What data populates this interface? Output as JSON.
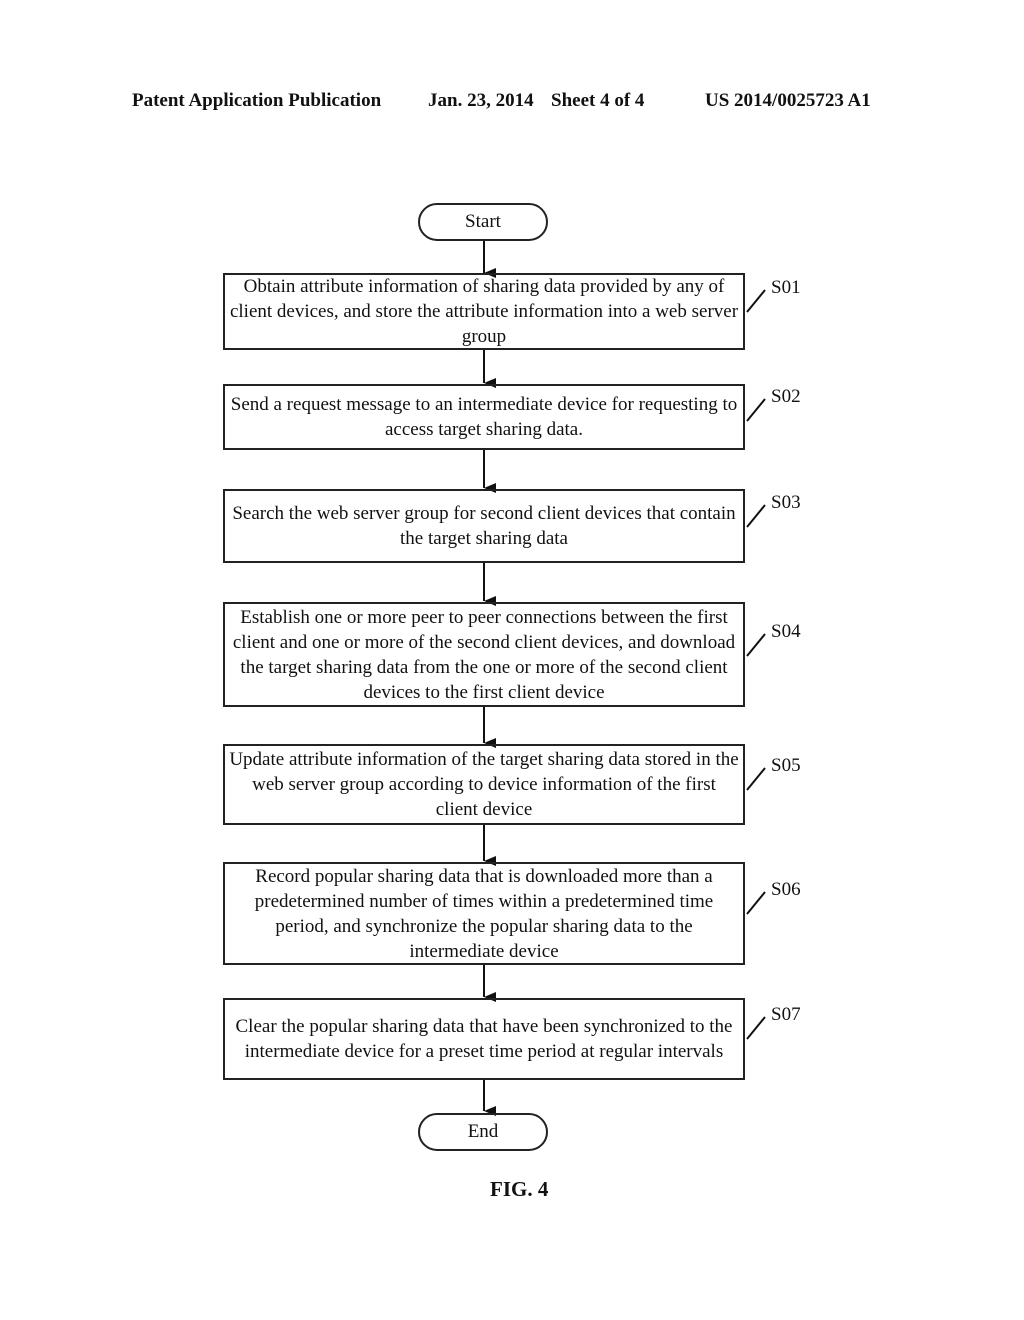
{
  "header": {
    "publication": "Patent Application Publication",
    "date": "Jan. 23, 2014",
    "sheet": "Sheet 4 of 4",
    "number": "US 2014/0025723 A1"
  },
  "flowchart": {
    "start": "Start",
    "end": "End",
    "steps": [
      {
        "id": "S01",
        "text": "Obtain attribute information of sharing data provided by any of client devices, and store the attribute information into a web server group"
      },
      {
        "id": "S02",
        "text": "Send a request message to an intermediate device for requesting to access target sharing data."
      },
      {
        "id": "S03",
        "text": "Search the web server group for second client devices that contain the target sharing data"
      },
      {
        "id": "S04",
        "text": "Establish one or more peer to peer connections between the first client and one or more of the second client devices, and download the target sharing data from the one or more of the second client devices to the first client device"
      },
      {
        "id": "S05",
        "text": "Update attribute information of the target sharing data stored in the web server group according to device information of the first client device"
      },
      {
        "id": "S06",
        "text": "Record popular sharing data that is downloaded more than a predetermined number of times within a predetermined time period, and synchronize the popular sharing data to the intermediate device"
      },
      {
        "id": "S07",
        "text": "Clear the popular sharing data that have been synchronized to the intermediate device for a preset time period at regular intervals"
      }
    ]
  },
  "figure_label": "FIG. 4"
}
